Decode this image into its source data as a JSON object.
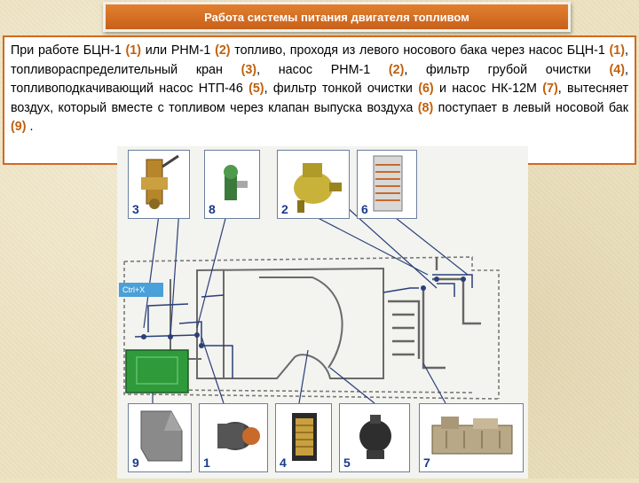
{
  "title": "Работа системы питания двигателя топливом",
  "description": {
    "segments": [
      {
        "t": "При работе БЦН-1 ",
        "h": false
      },
      {
        "t": "(1)",
        "h": true
      },
      {
        "t": " или РНМ-1 ",
        "h": false
      },
      {
        "t": "(2)",
        "h": true
      },
      {
        "t": " топливо, проходя из левого носового бака через насос БЦН-1 ",
        "h": false
      },
      {
        "t": "(1)",
        "h": true
      },
      {
        "t": ", топливораспределительный кран ",
        "h": false
      },
      {
        "t": "(3)",
        "h": true
      },
      {
        "t": ", насос РНМ-1 ",
        "h": false
      },
      {
        "t": "(2)",
        "h": true
      },
      {
        "t": ", фильтр грубой очистки ",
        "h": false
      },
      {
        "t": "(4)",
        "h": true
      },
      {
        "t": ", топливоподкачивающий насос НТП-46 ",
        "h": false
      },
      {
        "t": "(5)",
        "h": true
      },
      {
        "t": ", фильтр тонкой очистки ",
        "h": false
      },
      {
        "t": "(6)",
        "h": true
      },
      {
        "t": " и насос НК-12М ",
        "h": false
      },
      {
        "t": "(7)",
        "h": true
      },
      {
        "t": ", вытесняет воздух, который вместе с топливом через клапан выпуска воздуха ",
        "h": false
      },
      {
        "t": "(8)",
        "h": true
      },
      {
        "t": " поступает в левый носовой бак ",
        "h": false
      },
      {
        "t": "(9)",
        "h": true
      },
      {
        "t": " .",
        "h": false
      }
    ]
  },
  "components_top": [
    {
      "label": "3",
      "icon": "distribution-valve-icon"
    },
    {
      "label": "8",
      "icon": "air-release-valve-icon"
    },
    {
      "label": "2",
      "icon": "pump-rnm1-icon"
    },
    {
      "label": "6",
      "icon": "fine-filter-icon"
    }
  ],
  "components_bottom": [
    {
      "label": "9",
      "icon": "fuel-tank-icon"
    },
    {
      "label": "1",
      "icon": "pump-btsn1-icon"
    },
    {
      "label": "4",
      "icon": "coarse-filter-icon"
    },
    {
      "label": "5",
      "icon": "pump-ntp46-icon"
    },
    {
      "label": "7",
      "icon": "pump-nk12m-icon"
    }
  ],
  "overlay_label": "Ctrl+X",
  "colors": {
    "title_bg": "#d2691e",
    "highlight": "#c0600c",
    "label": "#1a3a8a",
    "lines": "#2a3f7a",
    "tank_fill": "#2e9a3a"
  }
}
